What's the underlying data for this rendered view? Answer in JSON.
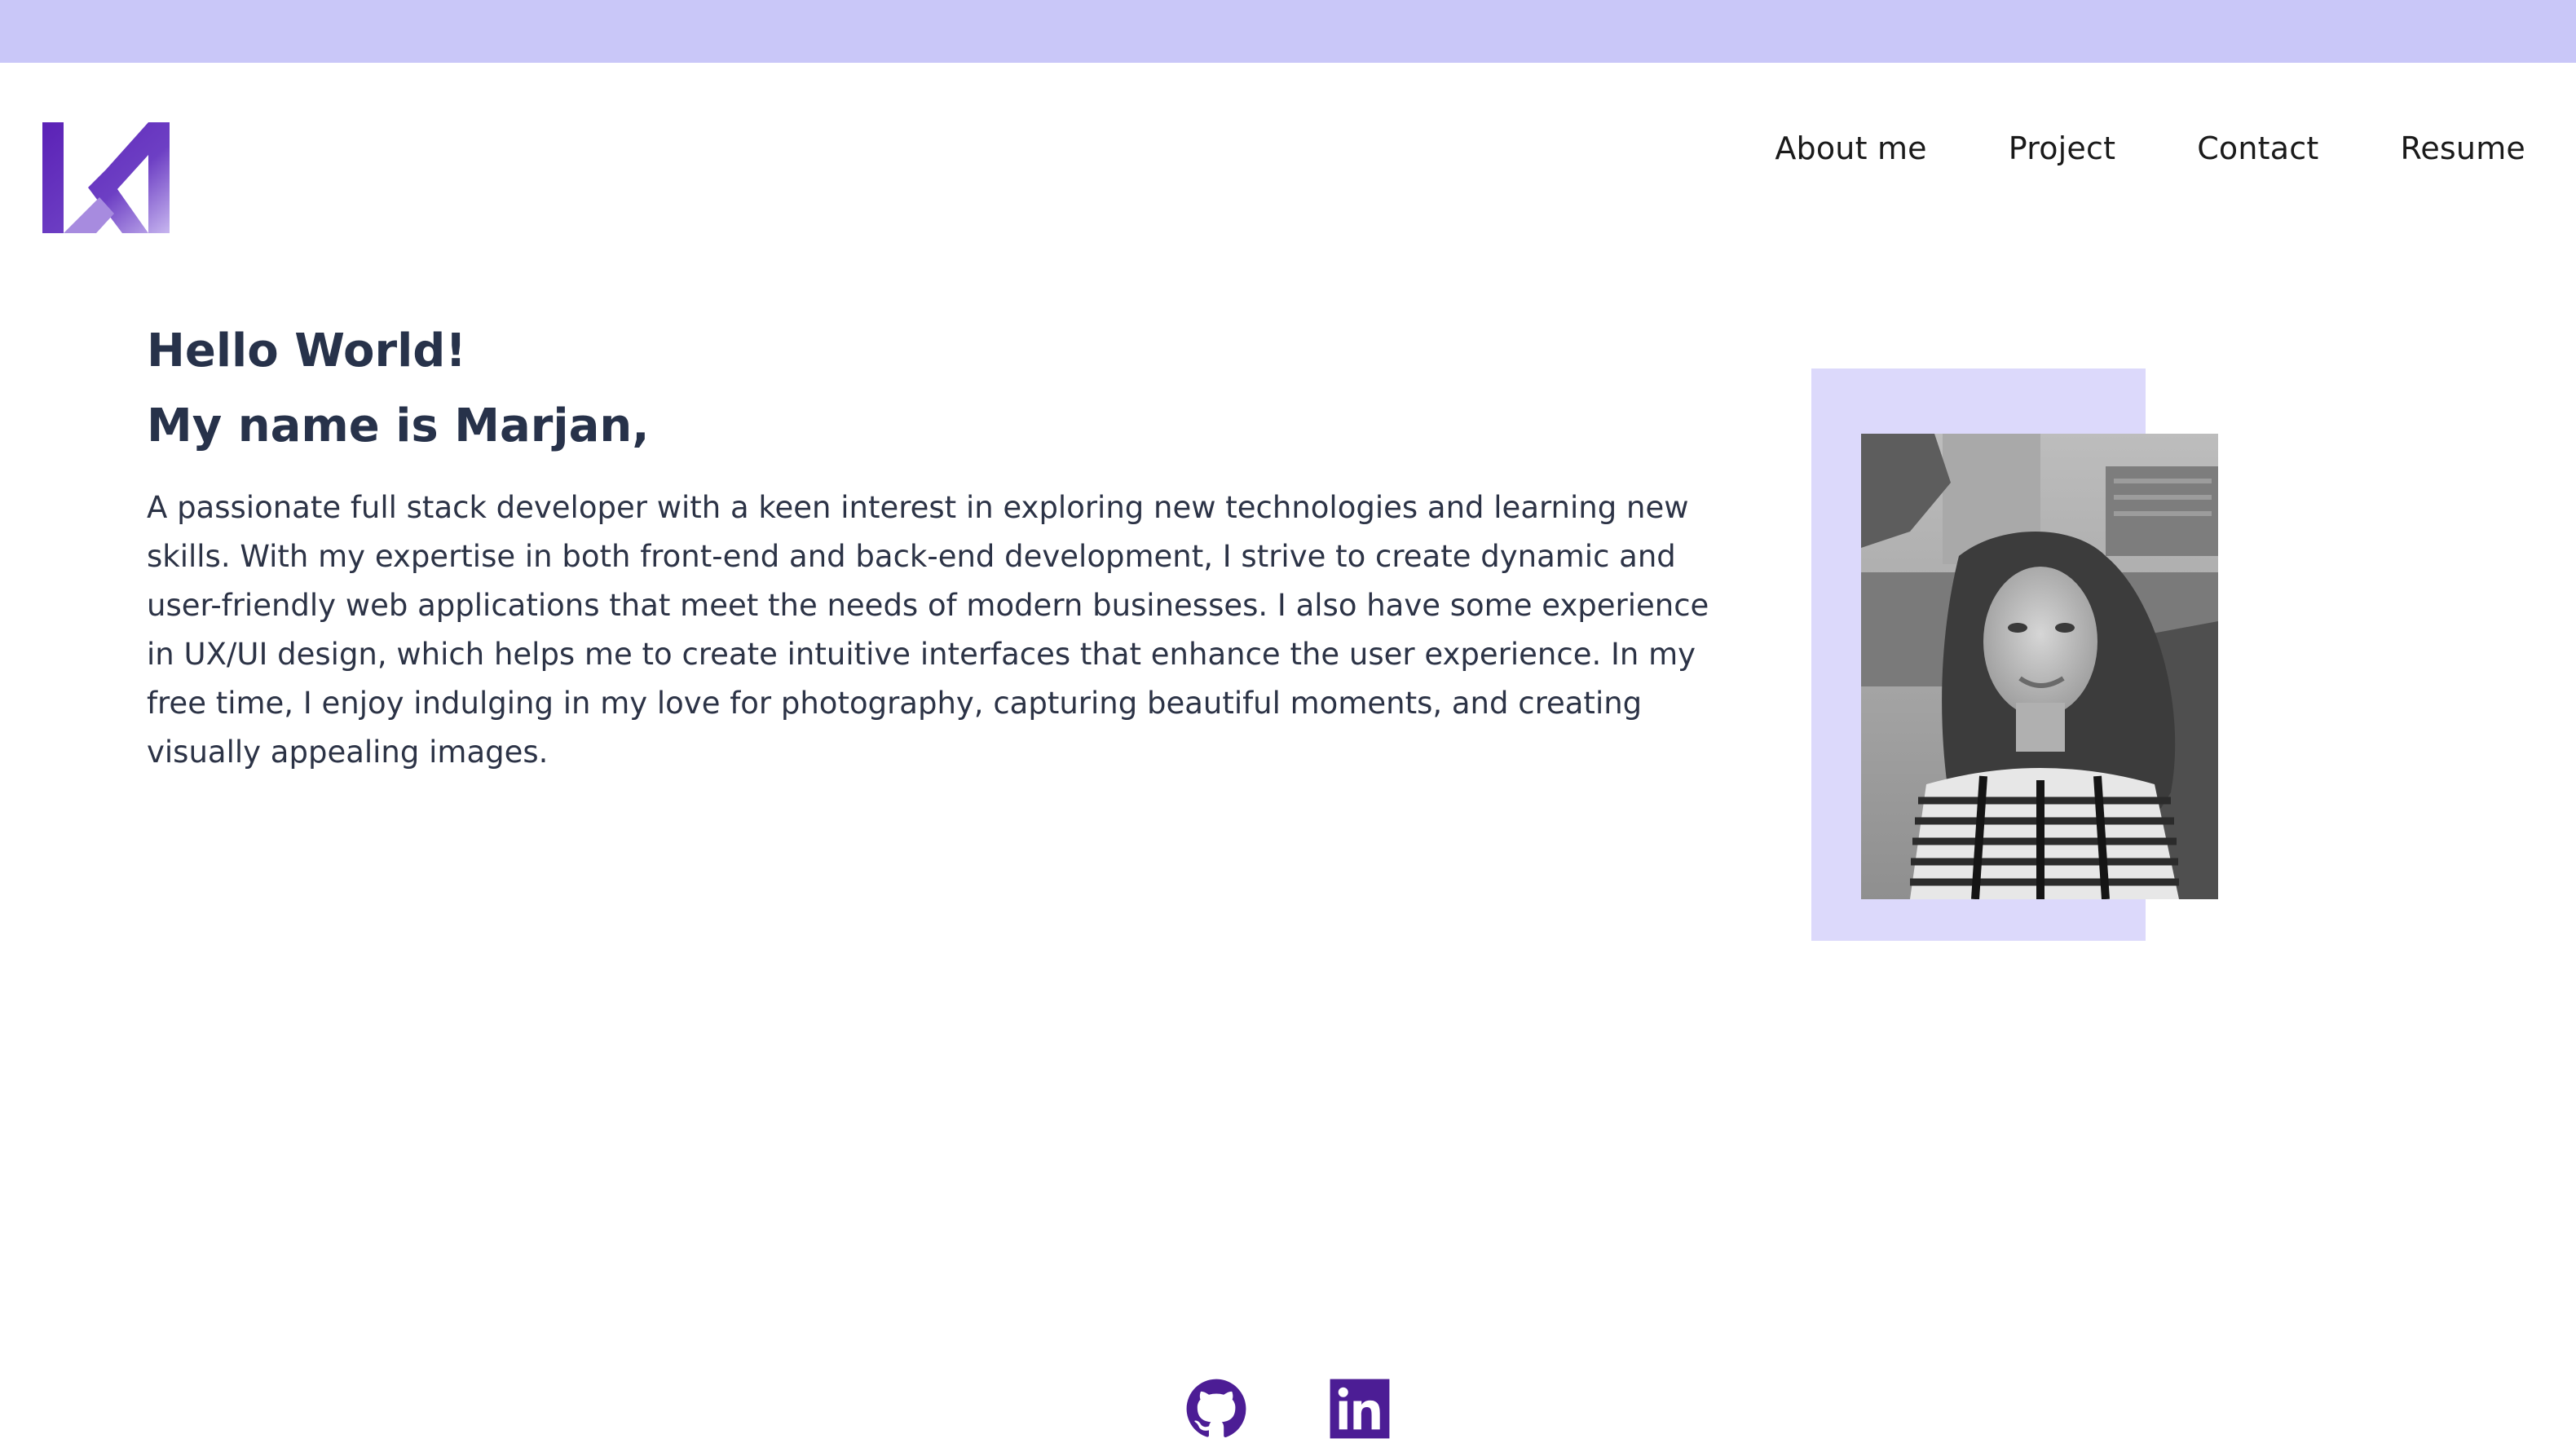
{
  "header": {
    "logo_icon": "m-monogram-logo-icon",
    "nav": [
      {
        "label": "About me"
      },
      {
        "label": "Project"
      },
      {
        "label": "Contact"
      },
      {
        "label": "Resume"
      }
    ]
  },
  "hero": {
    "greeting": "Hello World!",
    "name_line": "My name is Marjan,",
    "bio": "A passionate full stack developer with a keen interest in exploring new technologies and learning new skills. With my expertise in both front-end and back-end development, I strive to create dynamic and user-friendly web applications that meet the needs of modern businesses. I also have some experience in UX/UI design, which helps me to create intuitive interfaces that enhance the user experience. In my free time, I enjoy indulging in my love for photography, capturing beautiful moments, and creating visually appealing images."
  },
  "photo": {
    "icon": "profile-photo"
  },
  "socials": [
    {
      "icon": "github-icon"
    },
    {
      "icon": "linkedin-icon"
    }
  ],
  "colors": {
    "topbar": "#c9c7f8",
    "accent": "#5b21b6",
    "photo_backdrop": "#dcd9fb",
    "heading": "#27324a"
  }
}
